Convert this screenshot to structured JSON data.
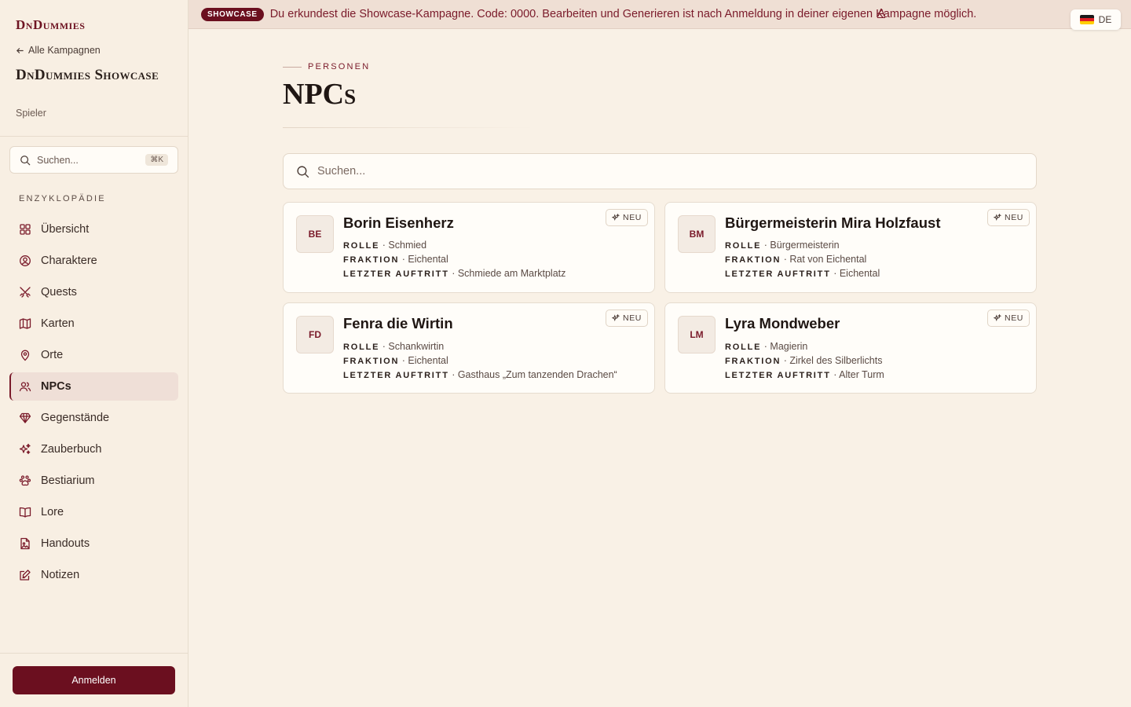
{
  "sidebar": {
    "brand": "DnDummies",
    "back_link": "Alle Kampagnen",
    "campaign_title": "DnDummies Showcase",
    "campaign_role": "Spieler",
    "search_placeholder": "Suchen...",
    "search_shortcut": "⌘K",
    "section_label": "ENZYKLOPÄDIE",
    "items": [
      {
        "label": "Übersicht",
        "icon": "grid-icon"
      },
      {
        "label": "Charaktere",
        "icon": "user-circle-icon"
      },
      {
        "label": "Quests",
        "icon": "crossed-swords-icon"
      },
      {
        "label": "Karten",
        "icon": "map-icon"
      },
      {
        "label": "Orte",
        "icon": "map-pin-icon"
      },
      {
        "label": "NPCs",
        "icon": "users-icon",
        "active": true
      },
      {
        "label": "Gegenstände",
        "icon": "gem-icon"
      },
      {
        "label": "Zauberbuch",
        "icon": "sparkles-icon"
      },
      {
        "label": "Bestiarium",
        "icon": "paw-icon"
      },
      {
        "label": "Lore",
        "icon": "book-open-icon"
      },
      {
        "label": "Handouts",
        "icon": "file-image-icon"
      },
      {
        "label": "Notizen",
        "icon": "note-edit-icon"
      }
    ],
    "login_label": "Anmelden"
  },
  "banner": {
    "badge": "SHOWCASE",
    "text": "Du erkundest die Showcase-Kampagne. Code: 0000. Bearbeiten und Generieren ist nach Anmeldung in deiner eigenen Kampagne möglich.",
    "cut_text": "A"
  },
  "language": {
    "code": "DE",
    "flag": "germany-flag-icon"
  },
  "main": {
    "eyebrow": "PERSONEN",
    "title": "NPCs",
    "search_placeholder": "Suchen...",
    "field_labels": {
      "role": "ROLLE",
      "faction": "FRAKTION",
      "last_seen": "LETZTER AUFTRITT"
    },
    "new_label": "NEU",
    "npcs": [
      {
        "initials": "BE",
        "name": "Borin Eisenherz",
        "role": "· Schmied",
        "faction": "· Eichental",
        "last_seen": "· Schmiede am Marktplatz"
      },
      {
        "initials": "BM",
        "name": "Bürgermeisterin Mira Holzfaust",
        "role": "· Bürgermeisterin",
        "faction": "· Rat von Eichental",
        "last_seen": "· Eichental"
      },
      {
        "initials": "FD",
        "name": "Fenra die Wirtin",
        "role": "· Schankwirtin",
        "faction": "· Eichental",
        "last_seen": "· Gasthaus „Zum tanzenden Drachen“"
      },
      {
        "initials": "LM",
        "name": "Lyra Mondweber",
        "role": "· Magierin",
        "faction": "· Zirkel des Silberlichts",
        "last_seen": "· Alter Turm"
      }
    ]
  },
  "colors": {
    "accent": "#6b0f1f",
    "background": "#f9f1e6",
    "sidebar": "#f8efe3",
    "banner": "#efdfd4"
  }
}
